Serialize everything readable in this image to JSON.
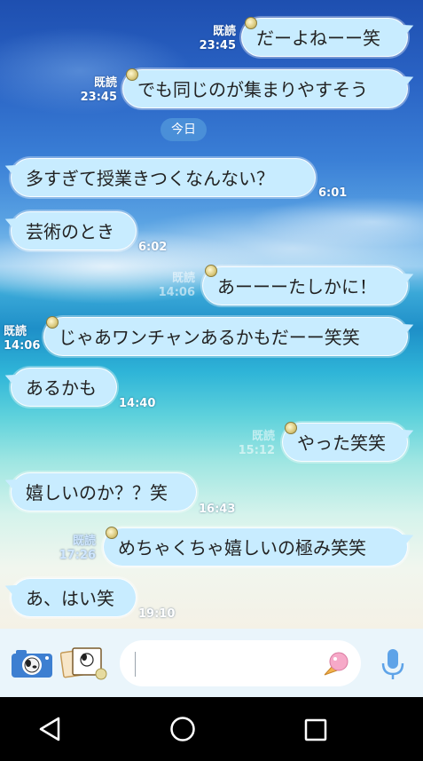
{
  "chat": {
    "messages": [
      {
        "text": "だーよねーー笑",
        "read": "既読",
        "time": "23:45"
      },
      {
        "text": "でも同じのが集まりやすそう",
        "read": "既読",
        "time": "23:45"
      },
      {
        "text": "多すぎて授業きつくなんない？",
        "time": "6:01"
      },
      {
        "text": "芸術のとき",
        "time": "6:02"
      },
      {
        "text": "あーーーたしかに！",
        "read": "既読",
        "time": "14:06"
      },
      {
        "text": "じゃあワンチャンあるかもだーー笑笑",
        "read": "既読",
        "time": "14:06"
      },
      {
        "text": "あるかも",
        "time": "14:40"
      },
      {
        "text": "やった笑笑",
        "read": "既読",
        "time": "15:12"
      },
      {
        "text": "嬉しいのか？？笑",
        "time": "16:43"
      },
      {
        "text": "めちゃくちゃ嬉しいの極み笑笑",
        "read": "既読",
        "time": "17:26"
      },
      {
        "text": "あ、はい笑",
        "time": "19:10"
      }
    ],
    "date_separator": "今日"
  },
  "input": {
    "placeholder": "",
    "camera_icon": "camera-icon",
    "photo_icon": "photo-icon",
    "sticker_icon": "ice-cream-sticker-icon",
    "mic_icon": "microphone-icon"
  },
  "nav": {
    "back_icon": "back-icon",
    "home_icon": "home-icon",
    "recent_icon": "recent-apps-icon"
  },
  "colors": {
    "bubble": "#c8ecff",
    "accent": "#4a8fd8"
  }
}
